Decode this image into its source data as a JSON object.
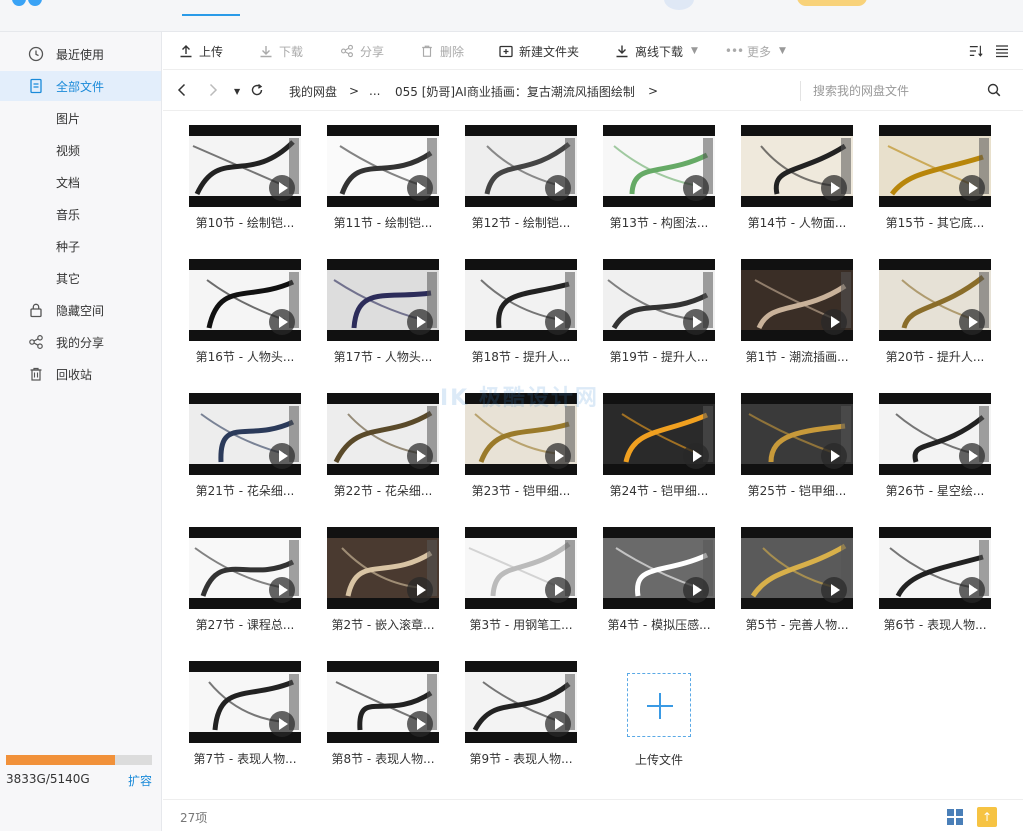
{
  "sidebar": {
    "items": [
      {
        "label": "最近使用",
        "icon": "clock-icon"
      },
      {
        "label": "全部文件",
        "icon": "file-icon"
      },
      {
        "label": "图片"
      },
      {
        "label": "视频"
      },
      {
        "label": "文档"
      },
      {
        "label": "音乐"
      },
      {
        "label": "种子"
      },
      {
        "label": "其它"
      },
      {
        "label": "隐藏空间",
        "icon": "lock-icon"
      },
      {
        "label": "我的分享",
        "icon": "share-icon"
      },
      {
        "label": "回收站",
        "icon": "trash-icon"
      }
    ],
    "active_index": 1,
    "storage": {
      "text": "3833G/5140G",
      "used_fraction": 0.746,
      "expand": "扩容",
      "bar_color": "#f1913a"
    }
  },
  "toolbar": {
    "upload": "上传",
    "download": "下载",
    "share": "分享",
    "delete": "删除",
    "new_folder": "新建文件夹",
    "offline_download": "离线下载",
    "more": "更多"
  },
  "path": {
    "root": "我的网盘",
    "sep": ">",
    "ellipsis": "...",
    "current": "055 [奶哥]AI商业插画：复古潮流风插图绘制",
    "search_placeholder": "搜索我的网盘文件"
  },
  "files": [
    {
      "name": "第10节 - 绘制铠..."
    },
    {
      "name": "第11节 - 绘制铠..."
    },
    {
      "name": "第12节 - 绘制铠..."
    },
    {
      "name": "第13节 - 构图法..."
    },
    {
      "name": "第14节 - 人物面..."
    },
    {
      "name": "第15节 - 其它底..."
    },
    {
      "name": "第16节 - 人物头..."
    },
    {
      "name": "第17节 - 人物头..."
    },
    {
      "name": "第18节 - 提升人..."
    },
    {
      "name": "第19节 - 提升人..."
    },
    {
      "name": "第1节 - 潮流插画..."
    },
    {
      "name": "第20节 - 提升人..."
    },
    {
      "name": "第21节 - 花朵细..."
    },
    {
      "name": "第22节 - 花朵细..."
    },
    {
      "name": "第23节 - 铠甲细..."
    },
    {
      "name": "第24节 - 铠甲细..."
    },
    {
      "name": "第25节 - 铠甲细..."
    },
    {
      "name": "第26节 - 星空绘..."
    },
    {
      "name": "第27节 - 课程总..."
    },
    {
      "name": "第2节 - 嵌入滚章..."
    },
    {
      "name": "第3节 - 用钢笔工..."
    },
    {
      "name": "第4节 - 模拟压感..."
    },
    {
      "name": "第5节 - 完善人物..."
    },
    {
      "name": "第6节 - 表现人物..."
    },
    {
      "name": "第7节 - 表现人物..."
    },
    {
      "name": "第8节 - 表现人物..."
    },
    {
      "name": "第9节 - 表现人物..."
    }
  ],
  "upload_tile": {
    "label": "上传文件"
  },
  "status": {
    "count": "27项"
  },
  "watermark": "IK 极酷设计网",
  "colors": {
    "accent": "#1a8ad9",
    "active_bg": "#e3eefb"
  }
}
